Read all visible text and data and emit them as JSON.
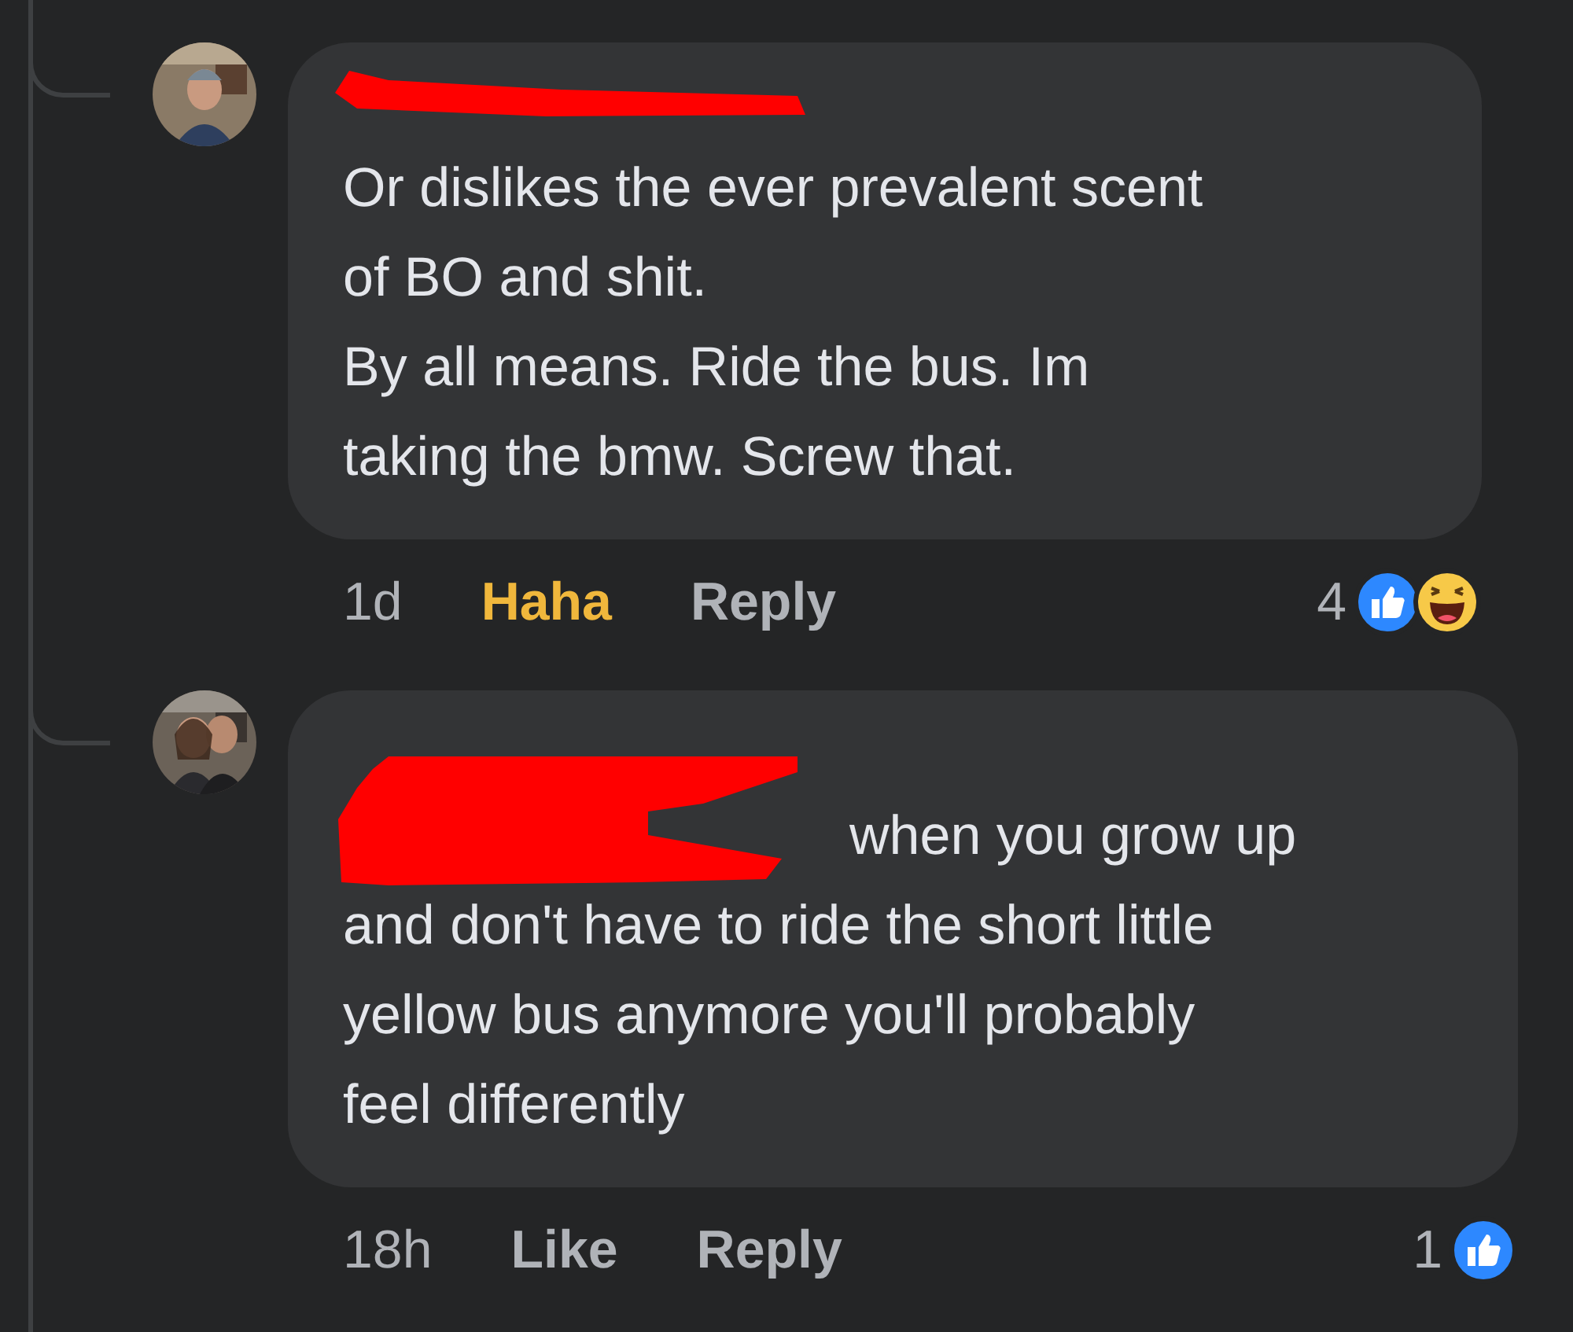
{
  "comments": [
    {
      "name_redacted": true,
      "mention_redacted": false,
      "body": "Or dislikes the ever prevalent scent\nof BO and shit.\nBy all means. Ride the bus. Im\ntaking the bmw. Screw that.",
      "time": "1d",
      "react_button": {
        "label": "Haha",
        "selected": true,
        "kind": "haha"
      },
      "reply_label": "Reply",
      "reaction_count": "4",
      "reaction_icons": [
        {
          "kind": "like"
        },
        {
          "kind": "haha"
        }
      ]
    },
    {
      "name_redacted": true,
      "mention_redacted": true,
      "body": "when you grow up\nand don't have to ride the short little\nyellow bus anymore you'll probably\nfeel differently",
      "time": "18h",
      "react_button": {
        "label": "Like",
        "selected": false
      },
      "reply_label": "Reply",
      "reaction_count": "1",
      "reaction_icons": [
        {
          "kind": "like"
        }
      ]
    }
  ]
}
